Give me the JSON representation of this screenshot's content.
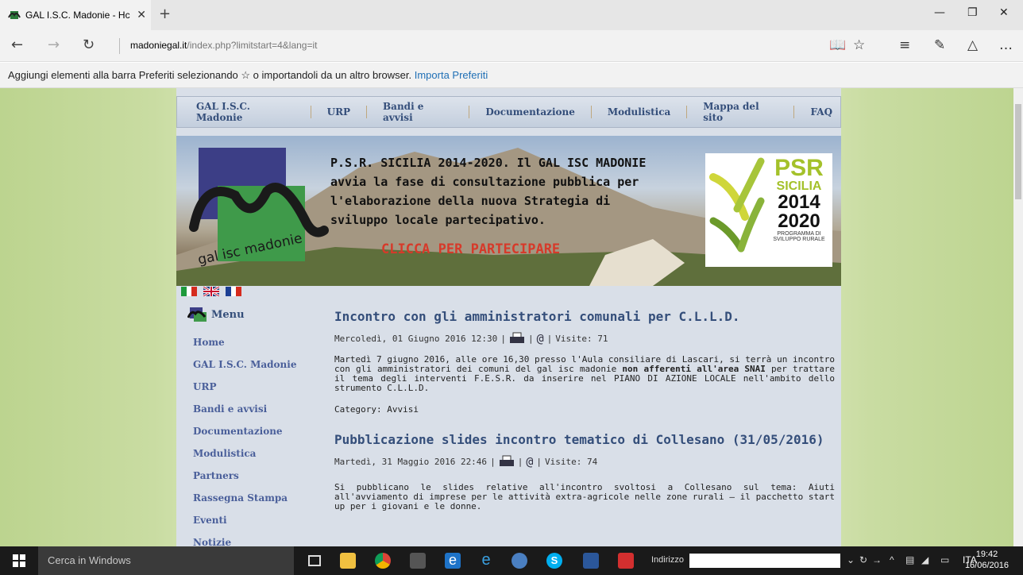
{
  "browser": {
    "tab_title": "GAL I.S.C. Madonie - Hc",
    "url_host": "madoniegal.it",
    "url_path": "/index.php?limitstart=4&lang=it",
    "favbar_text": "Aggiungi elementi alla barra Preferiti selezionando ☆ o importandoli da un altro browser.",
    "favbar_link": "Importa Preferiti"
  },
  "topnav": [
    "GAL I.S.C. Madonie",
    "URP",
    "Bandi e avvisi",
    "Documentazione",
    "Modulistica",
    "Mappa del sito",
    "FAQ"
  ],
  "banner": {
    "headline": [
      "P.S.R. SICILIA 2014-2020. Il GAL ISC MADONIE",
      "avvia la fase di consultazione pubblica per",
      "l'elaborazione della nuova Strategia di",
      "sviluppo locale partecipativo."
    ],
    "cta": "CLICCA PER PARTECIPARE",
    "logo_text": "gal isc madonie",
    "psr": {
      "title": "PSR",
      "region": "SICILIA",
      "year1": "2014",
      "year2": "2020",
      "sub1": "PROGRAMMA DI",
      "sub2": "SVILUPPO RURALE"
    }
  },
  "menu": {
    "title": "Menu",
    "items": [
      "Home",
      "GAL I.S.C. Madonie",
      "URP",
      "Bandi e avvisi",
      "Documentazione",
      "Modulistica",
      "Partners",
      "Rassegna Stampa",
      "Eventi",
      "Notizie"
    ]
  },
  "articles": [
    {
      "title": "Incontro con gli amministratori comunali per C.L.L.D.",
      "date": "Mercoledì, 01 Giugno 2016 12:30",
      "visits": "Visite: 71",
      "body_pre": "Martedì 7 giugno 2016, alle ore 16,30 presso l'Aula consiliare di Lascari, si terrà un incontro con gli amministratori dei comuni del gal isc madonie ",
      "body_bold": "non afferenti all'area SNAI",
      "body_post": " per trattare il tema degli interventi F.E.S.R. da inserire nel PIANO DI AZIONE LOCALE nell'ambito dello strumento C.L.L.D.",
      "category": "Category: Avvisi"
    },
    {
      "title": "Pubblicazione slides incontro tematico di Collesano (31/05/2016)",
      "date": "Martedì, 31 Maggio 2016 22:46",
      "visits": "Visite: 74",
      "body_pre": "Si pubblicano le slides relative all'incontro svoltosi a Collesano sul tema: Aiuti all'avviamento di imprese per le attività extra-agricole nelle zone rurali – il pacchetto start up per i giovani e le donne.",
      "body_bold": "",
      "body_post": "",
      "category": ""
    }
  ],
  "taskbar": {
    "search_placeholder": "Cerca in Windows",
    "address_label": "Indirizzo",
    "lang": "ITA",
    "time": "19:42",
    "date": "16/06/2016"
  }
}
